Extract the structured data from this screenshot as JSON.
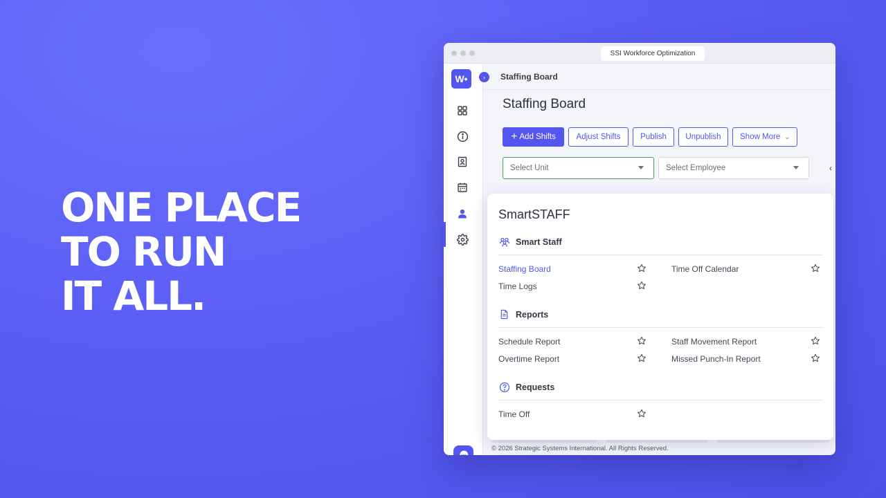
{
  "headline": [
    "ONE PLACE",
    "TO RUN",
    "IT ALL."
  ],
  "window": {
    "title": "SSI Workforce Optimization"
  },
  "sidebar": {
    "logo_text": "W•",
    "icons": [
      "dashboard-grid-icon",
      "info-icon",
      "contact-card-icon",
      "calendar-icon",
      "user-icon",
      "gear-icon"
    ],
    "active_item": "user-icon",
    "support_icon": "chat-support-icon"
  },
  "breadcrumb": "Staffing Board",
  "page_title": "Staffing Board",
  "toolbar": {
    "add_shifts": "Add Shifts",
    "adjust_shifts": "Adjust Shifts",
    "publish": "Publish",
    "unpublish": "Unpublish",
    "show_more": "Show More"
  },
  "filters": {
    "unit_placeholder": "Select Unit",
    "employee_placeholder": "Select Employee"
  },
  "menu": {
    "title": "SmartSTAFF",
    "sections": [
      {
        "heading": "Smart Staff",
        "icon": "people-group-icon",
        "items": [
          "Staffing Board",
          "Time Off Calendar",
          "Time Logs"
        ]
      },
      {
        "heading": "Reports",
        "icon": "document-icon",
        "items": [
          "Schedule Report",
          "Staff Movement Report",
          "Overtime Report",
          "Missed Punch-In Report"
        ]
      },
      {
        "heading": "Requests",
        "icon": "question-circle-icon",
        "items": [
          "Time Off"
        ]
      }
    ],
    "active_item": "Staffing Board"
  },
  "footer": "© 2026 Strategic Systems International. All Rights Reserved.",
  "colors": {
    "background": "#5b5ef5",
    "accent": "#5356ee",
    "focus_border": "#3fa35a"
  }
}
